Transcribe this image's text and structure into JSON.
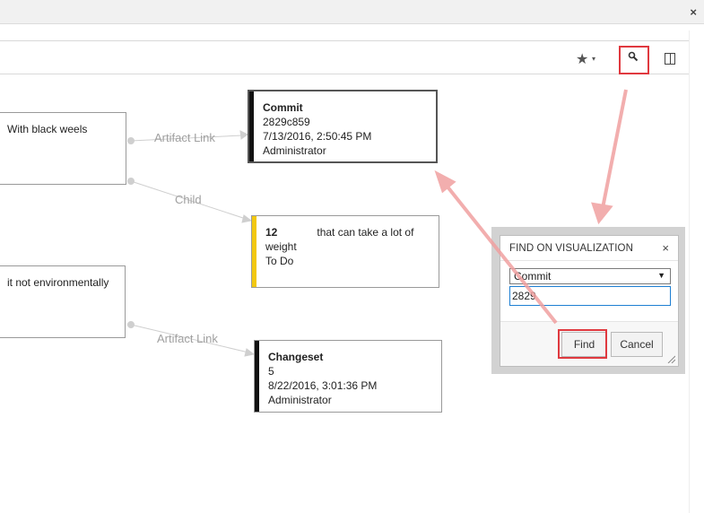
{
  "window": {
    "close_glyph": "×"
  },
  "toolbar": {
    "favorite_icon": "★",
    "favorite_caret": "▾",
    "search_icon": "🔍",
    "panel_icon": "panel-toggle-icon"
  },
  "nodes": {
    "left_top": {
      "text": "With black weels"
    },
    "left_bottom": {
      "text": "it not environmentally"
    },
    "commit": {
      "title": "Commit",
      "id": "2829c859",
      "date": "7/13/2016, 2:50:45 PM",
      "author": "Administrator",
      "color": "#111111"
    },
    "task": {
      "title": "12",
      "text1": "that can take a lot of",
      "text2": "weight",
      "state": "To Do",
      "color": "#f2c811"
    },
    "changeset": {
      "title": "Changeset",
      "id": "5",
      "date": "8/22/2016, 3:01:36 PM",
      "author": "Administrator",
      "color": "#111111"
    }
  },
  "edges": {
    "link1": "Artifact Link",
    "link2": "Child",
    "link3": "Artifact Link"
  },
  "dialog": {
    "title": "FIND ON VISUALIZATION",
    "close_glyph": "×",
    "type_selected": "Commit",
    "search_value": "2829",
    "find_label": "Find",
    "cancel_label": "Cancel"
  },
  "colors": {
    "highlight": "#e0393f",
    "arrow": "#f0a0a0"
  }
}
